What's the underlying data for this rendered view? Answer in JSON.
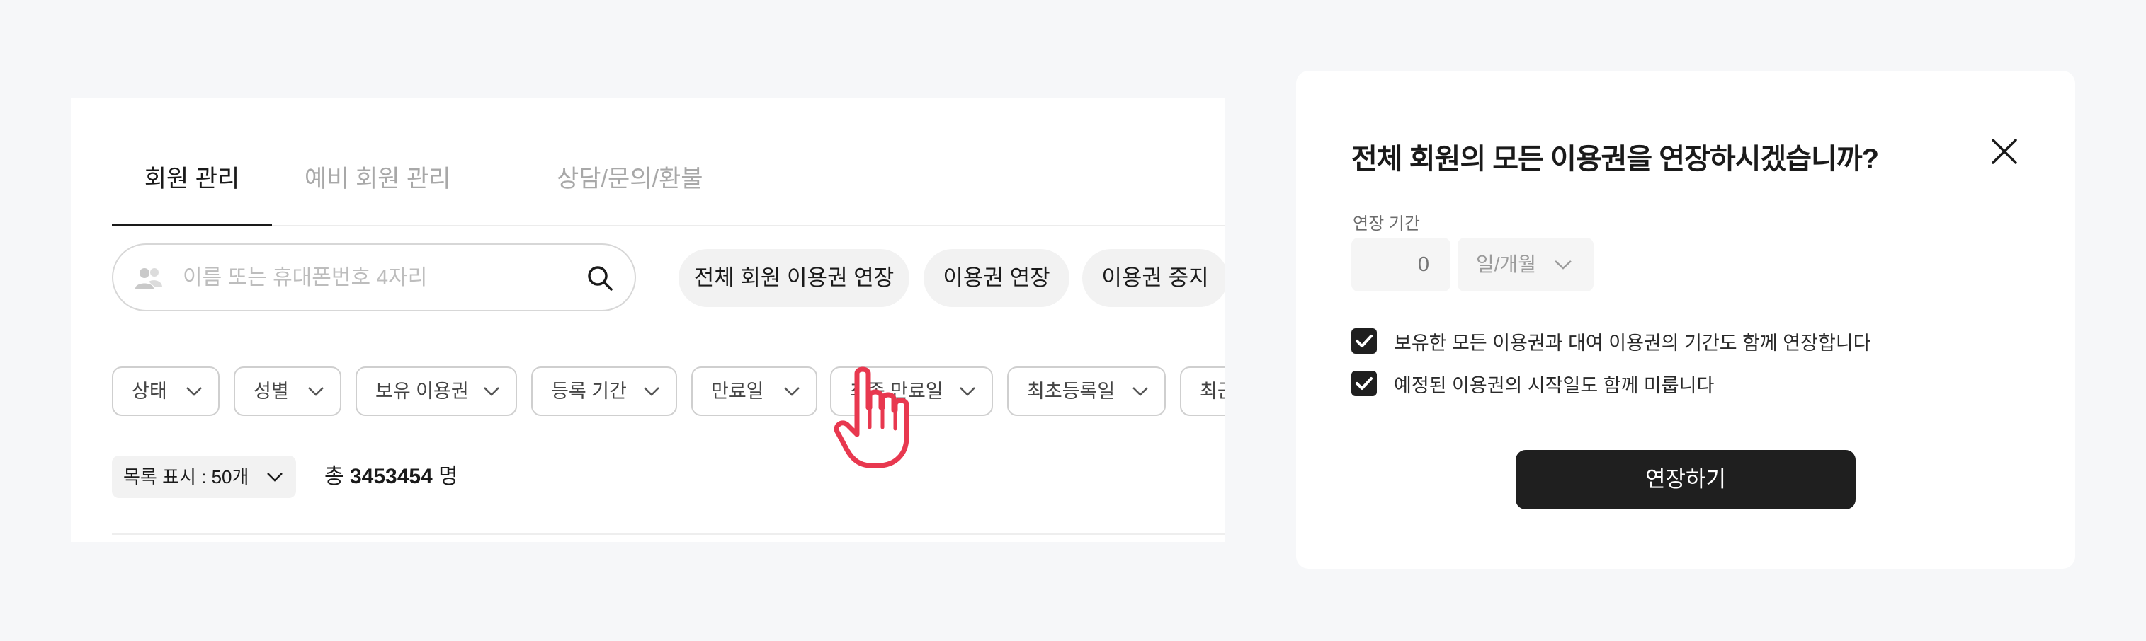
{
  "tabs": [
    "회원 관리",
    "예비 회원 관리",
    "상담/문의/환불"
  ],
  "search": {
    "placeholder": "이름 또는 휴대폰번호 4자리",
    "value": ""
  },
  "actions": [
    "전체 회원 이용권 연장",
    "이용권 연장",
    "이용권 중지"
  ],
  "filters": [
    "상태",
    "성별",
    "보유 이용권",
    "등록 기간",
    "만료일",
    "최종 만료일",
    "최초등록일",
    "최근"
  ],
  "list": {
    "display": "목록 표시 : 50개",
    "total_prefix": "총",
    "total_count": "3453454",
    "total_suffix": "명"
  },
  "modal": {
    "title": "전체 회원의 모든 이용권을 연장하시겠습니까?",
    "extension_label": "연장 기간",
    "extension_value": "0",
    "unit": "일/개월",
    "options": [
      {
        "label": "보유한 모든 이용권과 대여 이용권의 기간도 함께 연장합니다",
        "checked": true
      },
      {
        "label": "예정된 이용권의 시작일도 함께 미룹니다",
        "checked": true
      }
    ],
    "submit": "연장하기"
  },
  "icons": [
    "people-icon",
    "search-icon",
    "chevron-down-icon",
    "pointing-hand-icon",
    "close-icon",
    "check-icon"
  ],
  "colors": {
    "background": "#f6f7f9",
    "panel": "#ffffff",
    "dark": "#1f1f1f",
    "pill": "#f2f2f2",
    "hand_accent": "#e8384f"
  }
}
